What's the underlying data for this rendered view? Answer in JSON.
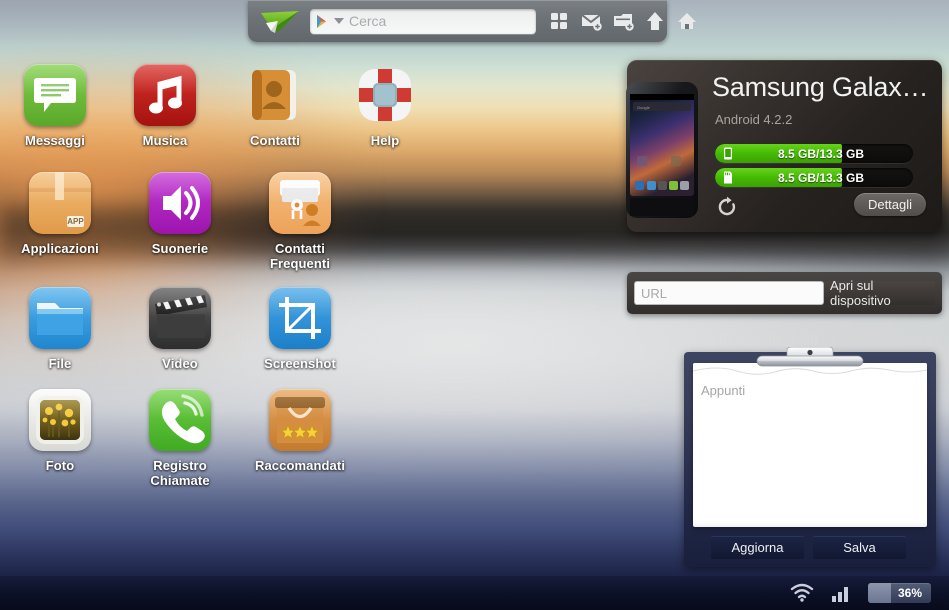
{
  "toolbar": {
    "logo_icon": "paper-plane-logo",
    "search_placeholder": "Cerca",
    "search_value": "",
    "play_icon": "google-play-icon",
    "dropdown_icon": "chevron-down-icon",
    "buttons": [
      {
        "name": "apps-grid-button",
        "icon": "grid-four-squares-icon"
      },
      {
        "name": "new-message-button",
        "icon": "envelope-plus-icon"
      },
      {
        "name": "new-contact-button",
        "icon": "card-plus-icon"
      },
      {
        "name": "upload-button",
        "icon": "upload-arrow-icon"
      },
      {
        "name": "home-button",
        "icon": "home-icon"
      }
    ]
  },
  "desktop": {
    "apps": [
      {
        "label": "Messaggi",
        "icon": "messages-icon",
        "color": "#6cbf35"
      },
      {
        "label": "Musica",
        "icon": "music-note-icon",
        "color": "#c0211f"
      },
      {
        "label": "Contatti",
        "icon": "address-book-icon",
        "color": "#d2832c"
      },
      {
        "label": "Help",
        "icon": "life-ring-icon",
        "color": "#e8e8e8"
      },
      {
        "label": "Applicazioni",
        "icon": "app-box-icon",
        "color": "#eda košn"
      },
      {
        "label": "Suonerie",
        "icon": "speaker-icon",
        "color": "#b32cc4"
      },
      {
        "label": "Contatti\nFrequenti",
        "icon": "frequent-contacts-icon",
        "color": "#f0a85a"
      },
      {
        "label": "File",
        "icon": "folder-icon",
        "color": "#2f9ae0"
      },
      {
        "label": "Video",
        "icon": "clapperboard-icon",
        "color": "#4a4a4a"
      },
      {
        "label": "Screenshot",
        "icon": "crop-icon",
        "color": "#2f93dd"
      },
      {
        "label": "Foto",
        "icon": "photo-frame-icon",
        "color": "#e8e4d8"
      },
      {
        "label": "Registro\nChiamate",
        "icon": "phone-handset-icon",
        "color": "#5cc23c"
      },
      {
        "label": "Raccomandati",
        "icon": "shopping-bag-stars-icon",
        "color": "#d9883c"
      }
    ]
  },
  "device": {
    "name": "Samsung Galax…",
    "os": "Android 4.2.2",
    "phone_image": "galaxy-nexus-phone",
    "storage": [
      {
        "icon": "phone-storage-icon",
        "used": "8.5 GB",
        "separator": " / ",
        "total": "13.3",
        "unit": "GB",
        "percent": 64
      },
      {
        "icon": "sd-card-icon",
        "used": "8.5 GB",
        "separator": " / ",
        "total": "13.3",
        "unit": "GB",
        "percent": 64
      }
    ],
    "refresh_icon": "refresh-icon",
    "details_label": "Dettagli"
  },
  "url_panel": {
    "placeholder": "URL",
    "value": "",
    "open_label": "Apri sul dispositivo"
  },
  "notes": {
    "placeholder": "Appunti",
    "value": "",
    "clip_icon": "clipboard-clip",
    "refresh_label": "Aggiorna",
    "save_label": "Salva"
  },
  "statusbar": {
    "wifi_icon": "wifi-icon",
    "signal_icon": "signal-bars-icon",
    "battery_label": "36%",
    "battery_percent": 36
  },
  "colors": {
    "accent_green": "#45b805",
    "toolbar_gray": "#6e7377",
    "panel_dark": "#262220",
    "notes_navy": "#1c2446"
  }
}
